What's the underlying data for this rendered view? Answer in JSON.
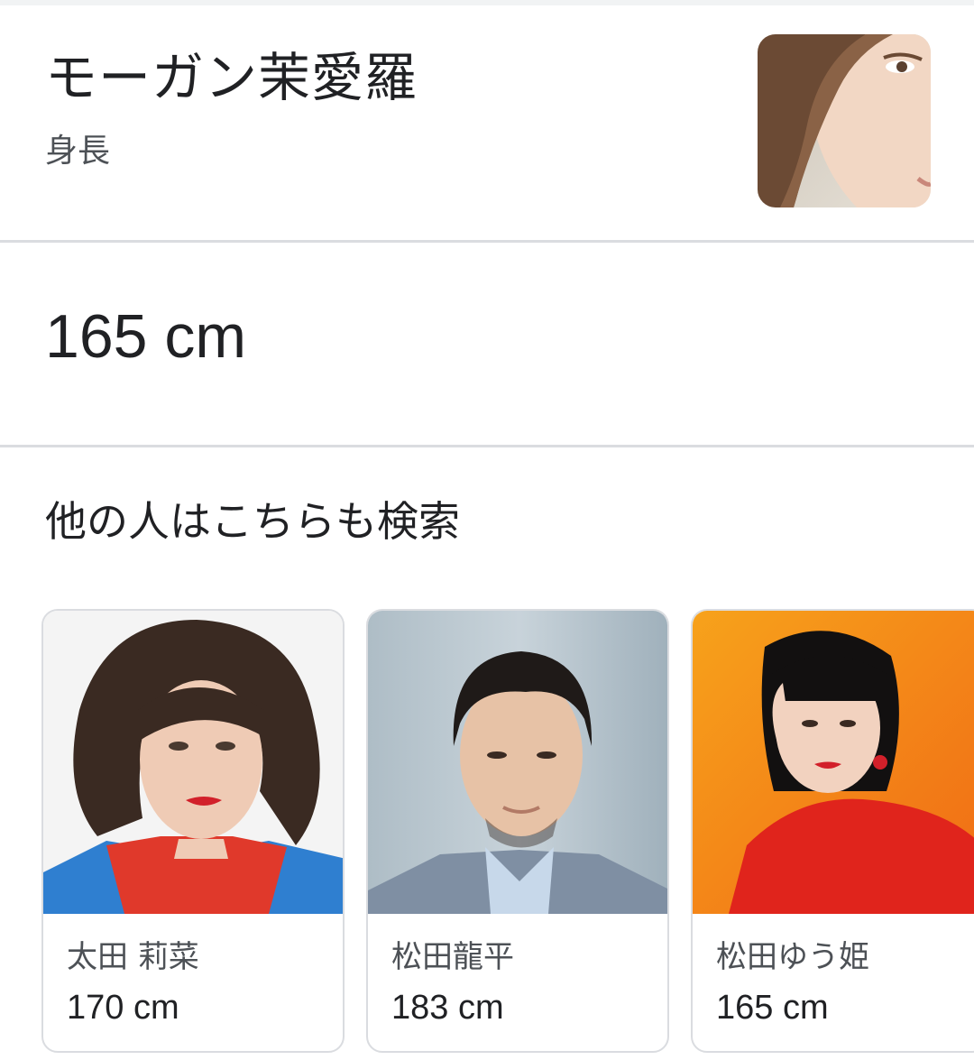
{
  "entity": {
    "name": "モーガン茉愛羅",
    "attribute": "身長"
  },
  "answer": {
    "value": "165 cm"
  },
  "related": {
    "title": "他の人はこちらも検索",
    "people": [
      {
        "name": "太田 莉菜",
        "height": "170 cm"
      },
      {
        "name": "松田龍平",
        "height": "183 cm"
      },
      {
        "name": "松田ゆう姫",
        "height": "165 cm"
      }
    ]
  },
  "colors": {
    "divider": "#dadce0",
    "text_primary": "#202124",
    "text_secondary": "#4d5156"
  }
}
